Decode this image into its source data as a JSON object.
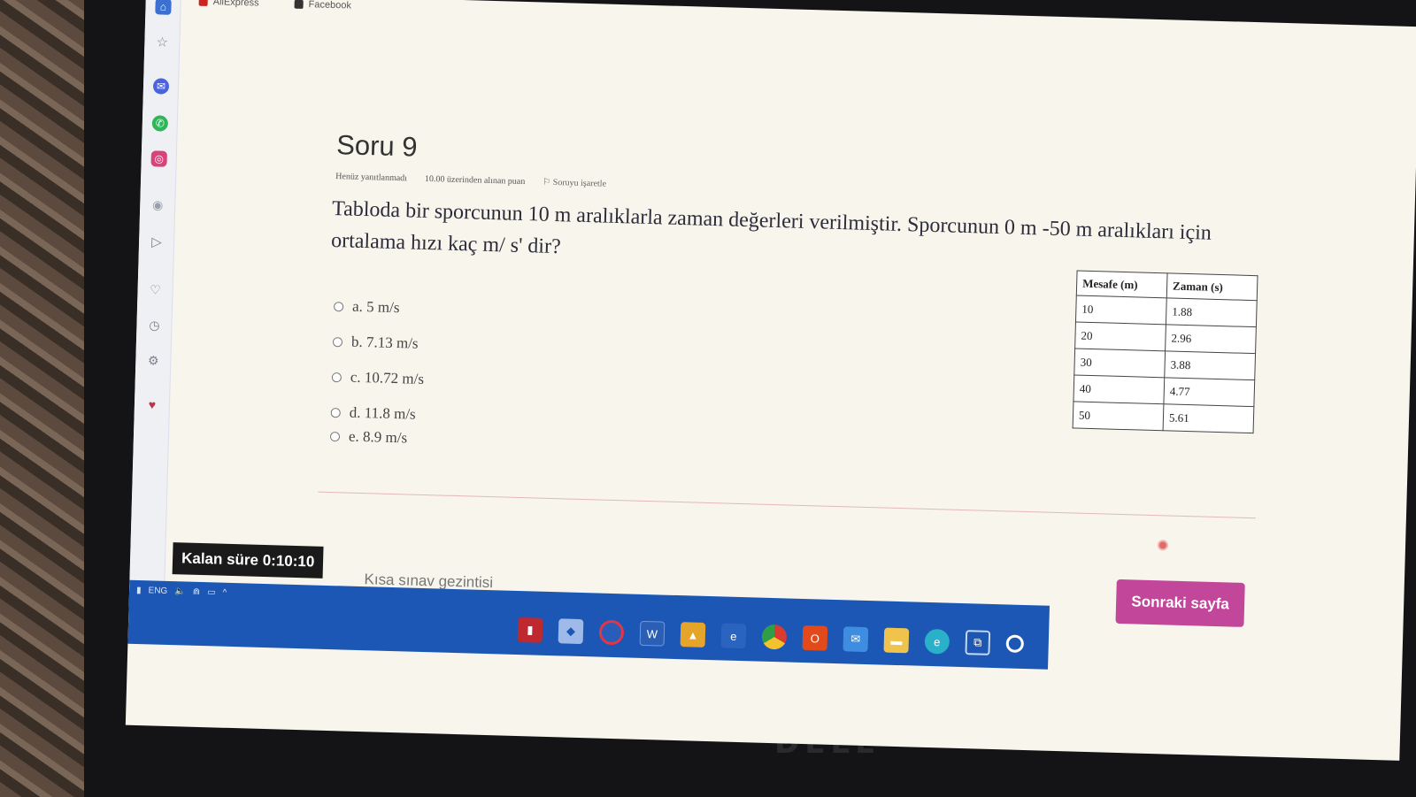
{
  "browser": {
    "bookmarks": [
      "AliExpress",
      "Facebook"
    ]
  },
  "question": {
    "title": "Soru 9",
    "status": "Henüz yanıtlanmadı",
    "points": "10.00 üzerinden alınan puan",
    "flag_label": "Soruyu işaretle",
    "text": "Tabloda bir sporcunun 10 m aralıklarla zaman değerleri verilmiştir. Sporcunun 0 m -50 m aralıkları için ortalama hızı kaç m/ s' dir?",
    "options": [
      "a. 5 m/s",
      "b. 7.13 m/s",
      "c. 10.72 m/s",
      "d. 11.8 m/s",
      "e. 8.9 m/s"
    ]
  },
  "table": {
    "headers": [
      "Mesafe (m)",
      "Zaman (s)"
    ],
    "rows": [
      [
        "10",
        "1.88"
      ],
      [
        "20",
        "2.96"
      ],
      [
        "30",
        "3.88"
      ],
      [
        "40",
        "4.77"
      ],
      [
        "50",
        "5.61"
      ]
    ]
  },
  "footer": {
    "timer_label": "Kalan süre",
    "timer_value": "0:10:10",
    "quiz_nav": "Kısa sınav gezintisi",
    "next_button": "Sonraki sayfa"
  },
  "taskbar": {
    "language": "ENG"
  },
  "laptop": {
    "brand": "DELL"
  }
}
